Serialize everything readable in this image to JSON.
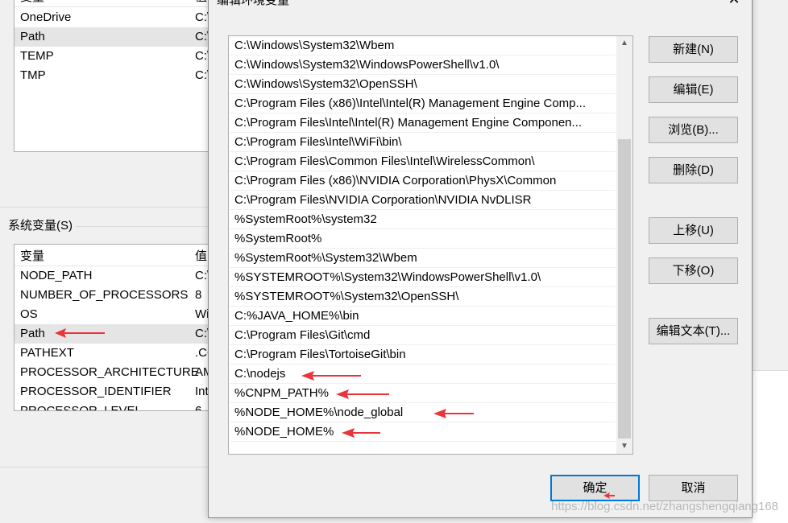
{
  "background_window": {
    "user_vars": [
      {
        "name": "OneDrive",
        "value": "C:\\",
        "selected": false
      },
      {
        "name": "Path",
        "value": "C:\\",
        "selected": true
      },
      {
        "name": "TEMP",
        "value": "C:\\",
        "selected": false
      },
      {
        "name": "TMP",
        "value": "C:\\",
        "selected": false
      }
    ],
    "user_header": {
      "col1": "变量",
      "col2": "值"
    },
    "system_group_label": "系统变量(S)",
    "system_header": {
      "col1": "变量",
      "col2": "值"
    },
    "system_vars": [
      {
        "name": "NODE_PATH",
        "value": "C:\\"
      },
      {
        "name": "NUMBER_OF_PROCESSORS",
        "value": "8"
      },
      {
        "name": "OS",
        "value": "Wi"
      },
      {
        "name": "Path",
        "value": "C:\\"
      },
      {
        "name": "PATHEXT",
        "value": ".CO"
      },
      {
        "name": "PROCESSOR_ARCHITECTURE",
        "value": "AM"
      },
      {
        "name": "PROCESSOR_IDENTIFIER",
        "value": "Int"
      },
      {
        "name": "PROCESSOR_LEVEL",
        "value": "6"
      }
    ]
  },
  "dialog": {
    "title": "编辑环境变量",
    "close_icon": "close-icon",
    "paths": [
      "C:\\Windows\\System32\\Wbem",
      "C:\\Windows\\System32\\WindowsPowerShell\\v1.0\\",
      "C:\\Windows\\System32\\OpenSSH\\",
      "C:\\Program Files (x86)\\Intel\\Intel(R) Management Engine Comp...",
      "C:\\Program Files\\Intel\\Intel(R) Management Engine Componen...",
      "C:\\Program Files\\Intel\\WiFi\\bin\\",
      "C:\\Program Files\\Common Files\\Intel\\WirelessCommon\\",
      "C:\\Program Files (x86)\\NVIDIA Corporation\\PhysX\\Common",
      "C:\\Program Files\\NVIDIA Corporation\\NVIDIA NvDLISR",
      "%SystemRoot%\\system32",
      "%SystemRoot%",
      "%SystemRoot%\\System32\\Wbem",
      "%SYSTEMROOT%\\System32\\WindowsPowerShell\\v1.0\\",
      "%SYSTEMROOT%\\System32\\OpenSSH\\",
      "C:%JAVA_HOME%\\bin",
      "C:\\Program Files\\Git\\cmd",
      "C:\\Program Files\\TortoiseGit\\bin",
      "C:\\nodejs",
      "%CNPM_PATH%",
      "%NODE_HOME%\\node_global",
      "%NODE_HOME%"
    ],
    "buttons": {
      "new": "新建(N)",
      "edit": "编辑(E)",
      "browse": "浏览(B)...",
      "delete": "删除(D)",
      "move_up": "上移(U)",
      "move_down": "下移(O)",
      "edit_text": "编辑文本(T)...",
      "ok": "确定",
      "cancel": "取消"
    }
  },
  "watermark": "https://blog.csdn.net/zhangshengqiang168",
  "colors": {
    "annotation_arrow": "#e8343a",
    "focus_border": "#0078d7"
  }
}
